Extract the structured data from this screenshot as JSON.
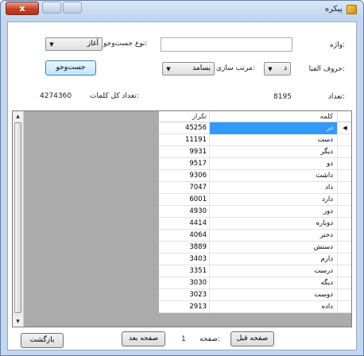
{
  "window": {
    "title": "پیکره",
    "close_label": "x"
  },
  "form": {
    "word_label": "واژه:",
    "word_value": "",
    "search_type_label": "نوع جست‌وجو:",
    "search_type_value": "آغاز",
    "first_letters_label": "حروف الفبا:",
    "first_letter_value": "د",
    "sort_label": "مرتب سازی:",
    "sort_value": "بسامد",
    "search_button": "جست‌وجو",
    "count_label": "تعداد:",
    "count_value": "8195",
    "total_words_label": "تعداد کل کلمات:",
    "total_words_value": "4274360"
  },
  "table": {
    "headers": {
      "word": "کلمه",
      "count": "تکرار"
    },
    "selected_marker": "◀",
    "rows": [
      {
        "word": "در",
        "count": "45256"
      },
      {
        "word": "دست",
        "count": "11191"
      },
      {
        "word": "دیگر",
        "count": "9931"
      },
      {
        "word": "دو",
        "count": "9517"
      },
      {
        "word": "داشت",
        "count": "9306"
      },
      {
        "word": "داد",
        "count": "7047"
      },
      {
        "word": "دارد",
        "count": "6001"
      },
      {
        "word": "دور",
        "count": "4930"
      },
      {
        "word": "دوباره",
        "count": "4414"
      },
      {
        "word": "دختر",
        "count": "4064"
      },
      {
        "word": "دستش",
        "count": "3889"
      },
      {
        "word": "دارم",
        "count": "3403"
      },
      {
        "word": "درست",
        "count": "3351"
      },
      {
        "word": "دیگه",
        "count": "3030"
      },
      {
        "word": "دوست",
        "count": "3023"
      },
      {
        "word": "داده",
        "count": "2913"
      }
    ]
  },
  "footer": {
    "back_button": "بازگشت",
    "next_button": "صفحه بعد",
    "page_label": "صفحه:",
    "page_value": "1",
    "prev_button": "صفحه قبل"
  }
}
